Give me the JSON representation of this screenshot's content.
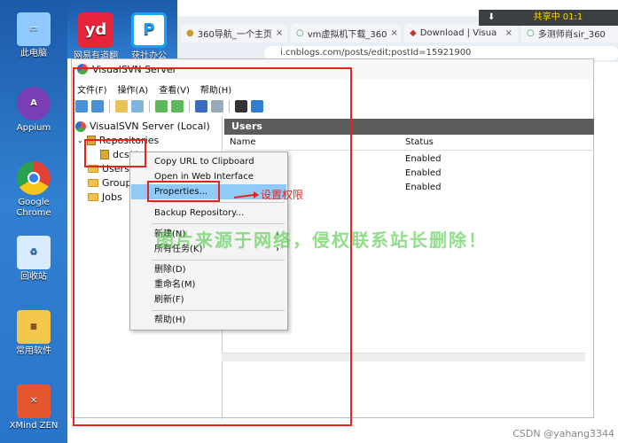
{
  "desktop": {
    "icons": [
      {
        "label": "此电脑",
        "icon": "computer-icon",
        "color": "#8ec9ff"
      },
      {
        "label": "Appium",
        "icon": "appium-icon",
        "color": "#7a3fb5"
      },
      {
        "label": "Google Chrome",
        "icon": "chrome-icon",
        "color": "#e34133"
      },
      {
        "label": "回收站",
        "icon": "recycle-bin-icon",
        "color": "#d9ecff"
      },
      {
        "label": "常用软件",
        "icon": "folder-icon",
        "color": "#f4c64c"
      },
      {
        "label": "XMind ZEN",
        "icon": "xmind-icon",
        "color": "#e4572e"
      }
    ],
    "top_apps": [
      {
        "label": "网易有道翻译",
        "glyph": "yd",
        "color": "#e8243a"
      },
      {
        "label": "获社办公",
        "glyph": "P",
        "color": "#1da1f2"
      }
    ]
  },
  "browser": {
    "tabs": [
      {
        "label": "360导航_一个主页"
      },
      {
        "label": "vm虚拟机下载_360"
      },
      {
        "label": "Download | Visua"
      },
      {
        "label": "多测师肖sir_360"
      }
    ],
    "close_glyph": "×",
    "address": "i.cnblogs.com/posts/edit;postId=15921900",
    "share_text": "共享中  01:1",
    "download_glyph": "⬇"
  },
  "window": {
    "title": "VisualSVN Server",
    "menu": [
      "文件(F)",
      "操作(A)",
      "查看(V)",
      "帮助(H)"
    ]
  },
  "tree": {
    "root": "VisualSVN Server (Local)",
    "repositories": "Repositories",
    "repo": "dcs**",
    "users": "Users",
    "groups": "Groups",
    "jobs": "Jobs"
  },
  "panel": {
    "header": "Users",
    "col_name": "Name",
    "col_status": "Status",
    "rows": [
      {
        "status": "Enabled"
      },
      {
        "status": "Enabled"
      },
      {
        "status": "Enabled"
      }
    ]
  },
  "context_menu": {
    "copy_url": "Copy URL to Clipboard",
    "open_web": "Open in Web Interface",
    "properties": "Properties...",
    "backup": "Backup Repository...",
    "new": "新建(N)",
    "all_tasks": "所有任务(K)",
    "delete": "删除(D)",
    "rename": "重命名(M)",
    "refresh": "刷新(F)",
    "help": "帮助(H)",
    "submenu_arrow": "›"
  },
  "annotation": {
    "text": "设置权限",
    "color": "#e3261c"
  },
  "watermark": "图片来源于网络，侵权联系站长删除！",
  "credit": "CSDN @yahang3344"
}
